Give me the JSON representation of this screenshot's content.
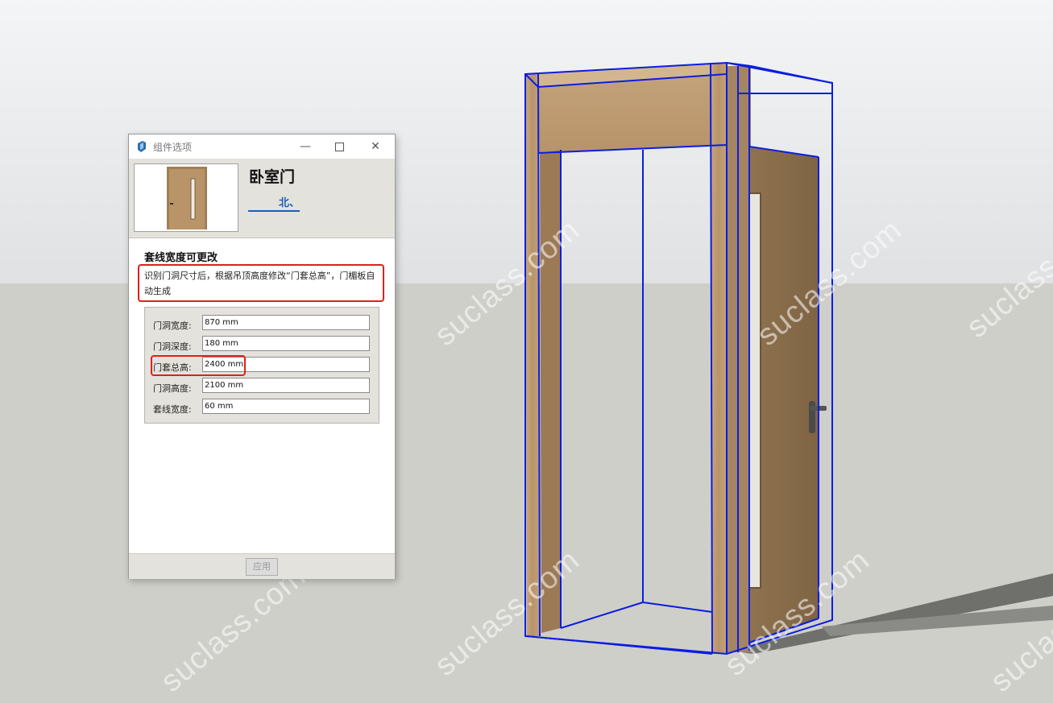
{
  "window": {
    "title": "组件选项"
  },
  "component": {
    "name": "卧室门",
    "link": "北、"
  },
  "section": {
    "title": "套线宽度可更改",
    "description": "识别门洞尺寸后，根据吊顶高度修改“门套总高”，门楣板自动生成"
  },
  "fields": [
    {
      "label": "门洞宽度:",
      "value": "870 mm"
    },
    {
      "label": "门洞深度:",
      "value": "180 mm"
    },
    {
      "label": "门套总高:",
      "value": "2400 mm"
    },
    {
      "label": "门洞高度:",
      "value": "2100 mm"
    },
    {
      "label": "套线宽度:",
      "value": "60 mm"
    }
  ],
  "footer": {
    "apply_label": "应用"
  },
  "watermark": "suclass.com",
  "colors": {
    "sky": "#e6e8ea",
    "ground": "#cfcfca",
    "wood": "#b8956a",
    "selection": "#0a1ee0",
    "highlight": "#e0201a"
  }
}
